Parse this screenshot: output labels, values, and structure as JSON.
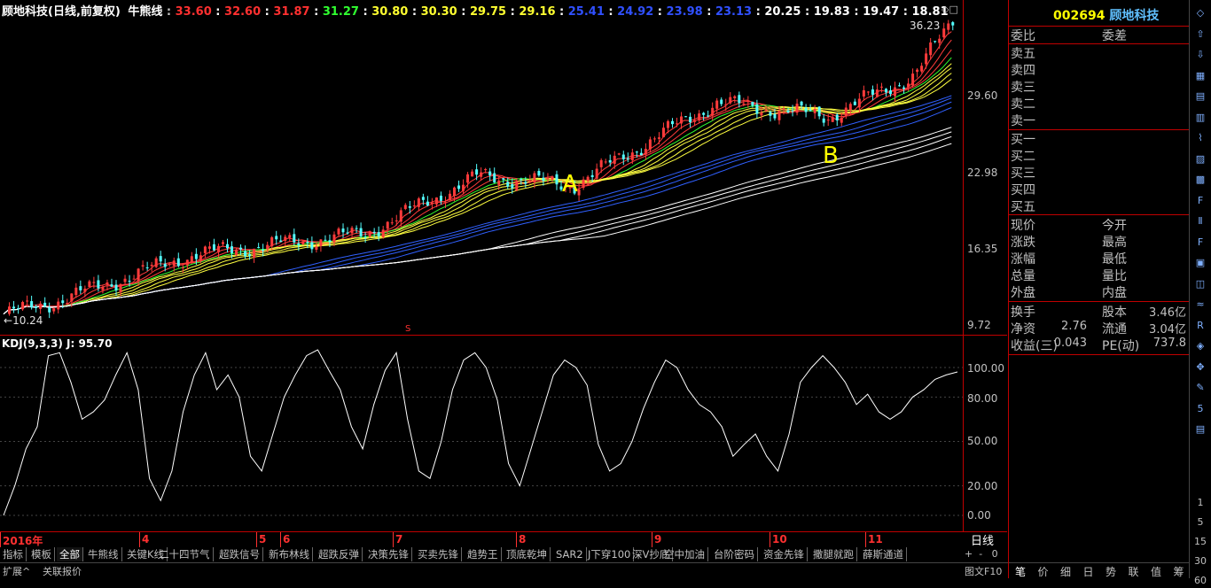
{
  "title": {
    "stock": "顾地科技(日线,前复权)",
    "indicator": "牛熊线",
    "values": [
      {
        "text": "33.60",
        "color": "#ff3030"
      },
      {
        "text": "32.60",
        "color": "#ff3030"
      },
      {
        "text": "31.87",
        "color": "#ff3030"
      },
      {
        "text": "31.27",
        "color": "#30ff30"
      },
      {
        "text": "30.80",
        "color": "#ffff30"
      },
      {
        "text": "30.30",
        "color": "#ffff30"
      },
      {
        "text": "29.75",
        "color": "#ffff30"
      },
      {
        "text": "29.16",
        "color": "#ffff30"
      },
      {
        "text": "25.41",
        "color": "#3050ff"
      },
      {
        "text": "24.92",
        "color": "#3050ff"
      },
      {
        "text": "23.98",
        "color": "#3050ff"
      },
      {
        "text": "23.13",
        "color": "#3050ff"
      },
      {
        "text": "20.25",
        "color": "#ffffff"
      },
      {
        "text": "19.83",
        "color": "#ffffff"
      },
      {
        "text": "19.47",
        "color": "#ffffff"
      },
      {
        "text": "18.81",
        "color": "#ffffff"
      }
    ]
  },
  "price_axis": [
    "29.60",
    "22.98",
    "16.35",
    "9.72"
  ],
  "kdj_axis": [
    "100.00",
    "80.00",
    "50.00",
    "20.00",
    "0.00"
  ],
  "kdj_label": "KDJ(9,3,3)  J: 95.70",
  "high_label": "36.23",
  "low_label": "10.24",
  "marker_a": "A",
  "marker_b": "B",
  "s_marker": "S",
  "dates": [
    {
      "text": "2016年",
      "pos": 0
    },
    {
      "text": "4",
      "pos": 157
    },
    {
      "text": "5",
      "pos": 289
    },
    {
      "text": "6",
      "pos": 316
    },
    {
      "text": "7",
      "pos": 443
    },
    {
      "text": "8",
      "pos": 582
    },
    {
      "text": "9",
      "pos": 735
    },
    {
      "text": "10",
      "pos": 868
    },
    {
      "text": "11",
      "pos": 976
    }
  ],
  "period": "日线",
  "tabs": [
    "指标",
    "模板",
    "全部",
    "牛熊线",
    "关键K线",
    "二十四节气",
    "超跌信号",
    "新布林线",
    "超跌反弹",
    "决策先锋",
    "买卖先锋",
    "趋势王",
    "顶底乾坤",
    "SAR2",
    "J下穿100",
    "深V抄底",
    "空中加油",
    "台阶密码",
    "资金先锋",
    "撒腿就跑",
    "薛斯通道"
  ],
  "active_tab": "全部",
  "bottom": {
    "expand": "扩展^",
    "related": "关联报价",
    "pic": "图文F10"
  },
  "quote": {
    "code": "002694",
    "name": "顾地科技",
    "weibi": "委比",
    "weicha": "委差",
    "sells": [
      "卖五",
      "卖四",
      "卖三",
      "卖二",
      "卖一"
    ],
    "buys": [
      "买一",
      "买二",
      "买三",
      "买四",
      "买五"
    ],
    "stats": [
      [
        "现价",
        "",
        "今开",
        ""
      ],
      [
        "涨跌",
        "",
        "最高",
        ""
      ],
      [
        "涨幅",
        "",
        "最低",
        ""
      ],
      [
        "总量",
        "",
        "量比",
        ""
      ],
      [
        "外盘",
        "",
        "内盘",
        ""
      ]
    ],
    "extra": [
      [
        "换手",
        "",
        "股本",
        "3.46亿"
      ],
      [
        "净资",
        "2.76",
        "流通",
        "3.04亿"
      ],
      [
        "收益(三)",
        "0.043",
        "PE(动)",
        "737.8"
      ]
    ]
  },
  "panel_tabs": [
    "笔",
    "价",
    "细",
    "日",
    "势",
    "联",
    "值",
    "筹"
  ],
  "side_numbers": [
    "1",
    "5",
    "15",
    "30",
    "60"
  ]
}
